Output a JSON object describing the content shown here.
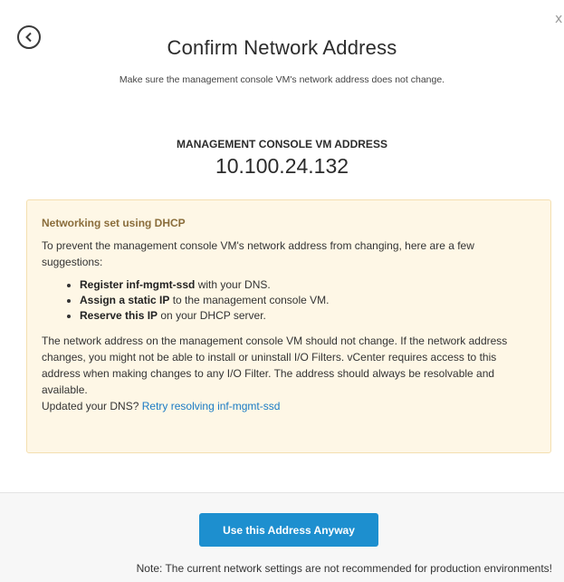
{
  "dialog": {
    "title": "Confirm Network Address",
    "subtitle": "Make sure the management console VM's network address does not change.",
    "back_icon": "chevron-left-icon",
    "close_icon": "close-icon",
    "close_glyph": "x"
  },
  "address": {
    "label": "MANAGEMENT CONSOLE VM ADDRESS",
    "value": "10.100.24.132"
  },
  "warning": {
    "title": "Networking set using DHCP",
    "intro": "To prevent the management console VM's network address from changing, here are a few suggestions:",
    "suggestions": [
      {
        "bold": "Register inf-mgmt-ssd",
        "rest": " with your DNS."
      },
      {
        "bold": "Assign a static IP",
        "rest": " to the management console VM."
      },
      {
        "bold": "Reserve this IP",
        "rest": " on your DHCP server."
      }
    ],
    "body": "The network address on the management console VM should not change. If the network address changes, you might not be able to install or uninstall I/O Filters. vCenter requires access to this address when making changes to any I/O Filter. The address should always be resolvable and available.",
    "dns_prompt": "Updated your DNS?",
    "retry_link": "Retry resolving inf-mgmt-ssd"
  },
  "footer": {
    "button_label": "Use this Address Anyway",
    "note": "Note: The current network settings are not recommended for production environments!"
  },
  "colors": {
    "primary_button": "#1d8fcf",
    "warning_background": "#fef7e6",
    "warning_border": "#f4dfb0",
    "warning_title": "#8a6d3b",
    "link": "#1a7bc4",
    "footer_background": "#f7f7f7"
  }
}
